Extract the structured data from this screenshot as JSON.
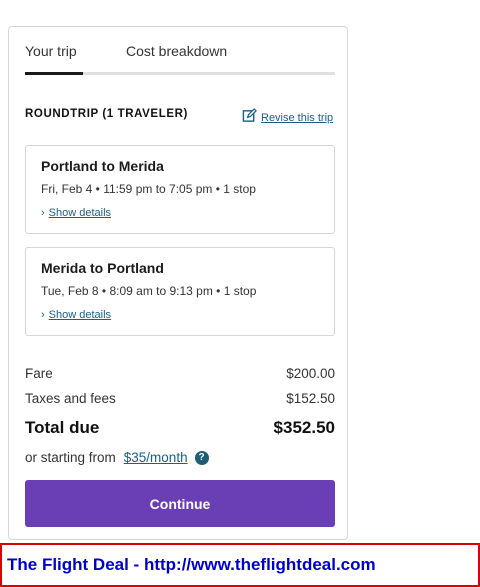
{
  "tabs": [
    {
      "label": "Your trip",
      "active": true
    },
    {
      "label": "Cost breakdown",
      "active": false
    }
  ],
  "trip": {
    "heading": "ROUNDTRIP (1 TRAVELER)",
    "revise_label": "Revise this trip"
  },
  "segments": [
    {
      "title": "Portland to Merida",
      "times": "Fri, Feb 4 • 11:59 pm to 7:05 pm • 1 stop",
      "details_label": "Show details"
    },
    {
      "title": "Merida to Portland",
      "times": "Tue, Feb 8 • 8:09 am to 9:13 pm • 1 stop",
      "details_label": "Show details"
    }
  ],
  "cost": {
    "fare_label": "Fare",
    "fare_value": "$200.00",
    "taxes_label": "Taxes and fees",
    "taxes_value": "$152.50",
    "total_label": "Total due",
    "total_value": "$352.50"
  },
  "financing": {
    "prefix": "or starting from",
    "link": "$35/month",
    "help_glyph": "?"
  },
  "continue_label": "Continue",
  "watermark": "The Flight Deal - http://www.theflightdeal.com",
  "colors": {
    "accent": "#6a3fb5",
    "link": "#1a5e8a",
    "watermark_border": "#dd0000",
    "watermark_text": "#0000cc"
  },
  "icons": {
    "revise": "edit-square-icon",
    "details": "chevron-right-icon",
    "help": "question-circle-icon"
  }
}
